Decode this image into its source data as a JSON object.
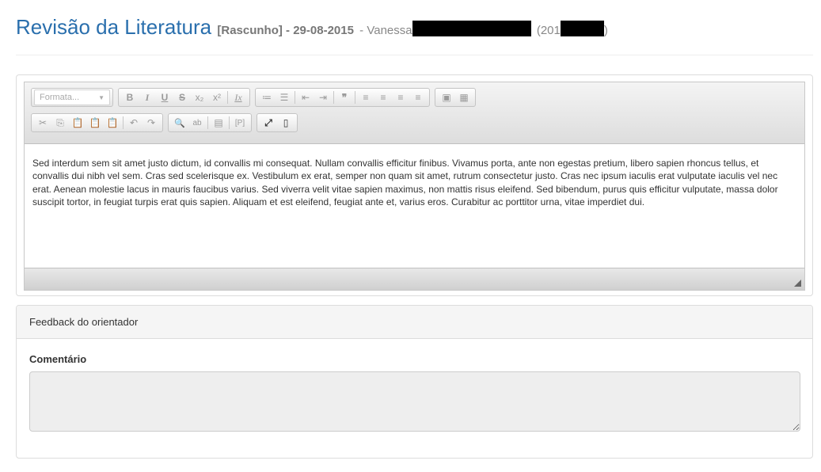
{
  "header": {
    "title": "Revisão da Literatura",
    "status": "[Rascunho] - 29-08-2015",
    "author_prefix": "- Vanessa",
    "id_open": "(201",
    "id_close": ")"
  },
  "toolbar": {
    "format_label": "Formata...",
    "row1": [
      [
        "bold-icon",
        "B"
      ],
      [
        "italic-icon",
        "I"
      ],
      [
        "underline-icon",
        "U"
      ],
      [
        "strikethrough-icon",
        "S"
      ],
      [
        "subscript-icon",
        "x₂"
      ],
      [
        "superscript-icon",
        "x²"
      ],
      [
        "remove-format-icon",
        "Ix"
      ],
      [
        "numbered-list-icon",
        "≔"
      ],
      [
        "bullet-list-icon",
        "☰"
      ],
      [
        "decrease-indent-icon",
        "⇤"
      ],
      [
        "increase-indent-icon",
        "⇥"
      ],
      [
        "blockquote-icon",
        "❞"
      ],
      [
        "align-left-icon",
        "≡"
      ],
      [
        "align-center-icon",
        "≡"
      ],
      [
        "align-right-icon",
        "≡"
      ],
      [
        "justify-icon",
        "≡"
      ],
      [
        "image-icon",
        "▣"
      ],
      [
        "table-icon",
        "▦"
      ]
    ],
    "row2": [
      [
        "cut-icon",
        "✂"
      ],
      [
        "copy-icon",
        "⎘"
      ],
      [
        "paste-icon",
        "📋"
      ],
      [
        "paste-text-icon",
        "📋"
      ],
      [
        "paste-word-icon",
        "📋"
      ],
      [
        "undo-icon",
        "↶"
      ],
      [
        "redo-icon",
        "↷"
      ],
      [
        "find-icon",
        "🔍"
      ],
      [
        "replace-icon",
        "ab"
      ],
      [
        "select-all-icon",
        "▤"
      ],
      [
        "show-blocks-icon",
        "[P]"
      ],
      [
        "maximize-icon",
        "⤢"
      ],
      [
        "source-icon",
        "▯"
      ]
    ]
  },
  "editor": {
    "content": "Sed interdum sem sit amet justo dictum, id convallis mi consequat. Nullam convallis efficitur finibus. Vivamus porta, ante non egestas pretium, libero sapien rhoncus tellus, et convallis dui nibh vel sem. Cras sed scelerisque ex. Vestibulum ex erat, semper non quam sit amet, rutrum consectetur justo. Cras nec ipsum iaculis erat vulputate iaculis vel nec erat. Aenean molestie lacus in mauris faucibus varius. Sed viverra velit vitae sapien maximus, non mattis risus eleifend. Sed bibendum, purus quis efficitur vulputate, massa dolor suscipit tortor, in feugiat turpis erat quis sapien. Aliquam et est eleifend, feugiat ante et, varius eros. Curabitur ac porttitor urna, vitae imperdiet dui."
  },
  "feedback": {
    "heading": "Feedback do orientador",
    "comment_label": "Comentário",
    "comment_value": ""
  }
}
